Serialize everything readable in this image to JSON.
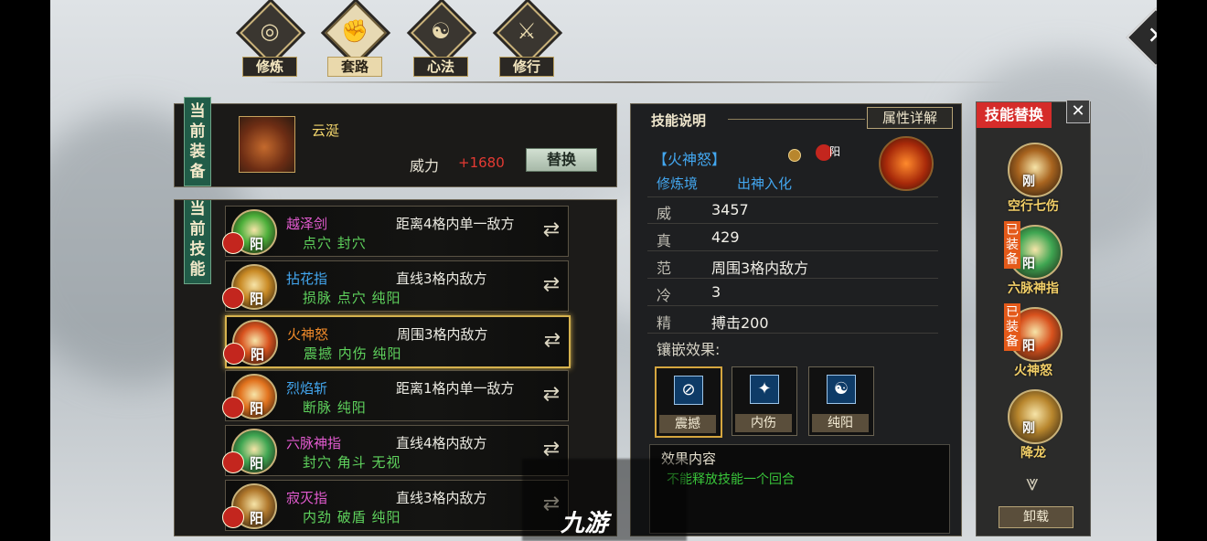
{
  "tabs": [
    {
      "label": "修炼",
      "glyph": "◎",
      "icon": "cultivation-icon",
      "active": false
    },
    {
      "label": "套路",
      "glyph": "✊",
      "icon": "fist-icon",
      "active": true
    },
    {
      "label": "心法",
      "glyph": "☯",
      "icon": "mind-method-icon",
      "active": false
    },
    {
      "label": "修行",
      "glyph": "⚔",
      "icon": "practice-icon",
      "active": false
    }
  ],
  "close_glyph": "✕",
  "equipment": {
    "tag": "当\n前\n装\n备",
    "name": "云涎",
    "power_label": "威力",
    "power_value": "+1680",
    "replace_label": "替换"
  },
  "current_skills": {
    "tag": "当\n前\n技\n能",
    "items": [
      {
        "name": "越泽剑",
        "name_color": "#e35bd0",
        "tags": "点穴  封穴",
        "range": "距离4格内单一敌方",
        "element": "阳",
        "icon_color": "#4caf3a",
        "selected": false
      },
      {
        "name": "拈花指",
        "name_color": "#43a7f0",
        "tags": "损脉  点穴  纯阳",
        "range": "直线3格内敌方",
        "element": "阳",
        "icon_color": "#c98a25",
        "selected": false
      },
      {
        "name": "火神怒",
        "name_color": "#ef8a2a",
        "tags": "震撼  内伤  纯阳",
        "range": "周围3格内敌方",
        "element": "阳",
        "icon_color": "#d8521e",
        "selected": true
      },
      {
        "name": "烈焰斩",
        "name_color": "#43a7f0",
        "tags": "断脉  纯阳",
        "range": "距离1格内单一敌方",
        "element": "阳",
        "icon_color": "#e2731e",
        "selected": false
      },
      {
        "name": "六脉神指",
        "name_color": "#e35bd0",
        "tags": "封穴  角斗  无视",
        "range": "直线4格内敌方",
        "element": "阳",
        "icon_color": "#3fa652",
        "selected": false
      },
      {
        "name": "寂灭指",
        "name_color": "#e35bd0",
        "tags": "内劲  破盾  纯阳",
        "range": "直线3格内敌方",
        "element": "阳",
        "icon_color": "#b0782c",
        "selected": false
      }
    ]
  },
  "skill_desc": {
    "title": "技能说明",
    "attr_button": "属性详解",
    "skill_name": "【火神怒】",
    "element": "阳",
    "realm_label": "修炼境",
    "realm_value": "出神入化",
    "stats": [
      {
        "key": "威",
        "value": "3457"
      },
      {
        "key": "真",
        "value": "429"
      },
      {
        "key": "范",
        "value": "周围3格内敌方"
      },
      {
        "key": "冷",
        "value": "3"
      },
      {
        "key": "精",
        "value": "搏击200"
      }
    ],
    "inlay_title": "镶嵌效果:",
    "inlays": [
      {
        "label": "震撼",
        "glyph": "⊘",
        "icon": "stun-icon",
        "selected": true
      },
      {
        "label": "内伤",
        "glyph": "✦",
        "icon": "internal-injury-icon",
        "selected": false
      },
      {
        "label": "纯阳",
        "glyph": "☯",
        "icon": "pure-yang-icon",
        "selected": false
      }
    ],
    "effect_title": "效果内容",
    "effect_text": "不能释放技能一个回合"
  },
  "skill_swap": {
    "title": "技能替换",
    "close_glyph": "✕",
    "items": [
      {
        "name": "空行七伤",
        "mark": "刚",
        "equipped": false,
        "icon_color": "#a8641f"
      },
      {
        "name": "六脉神指",
        "mark": "阳",
        "equipped": true,
        "tag": "已装备",
        "icon_color": "#3fa652"
      },
      {
        "name": "火神怒",
        "mark": "阳",
        "equipped": true,
        "tag": "已装备",
        "icon_color": "#d8521e"
      },
      {
        "name": "降龙",
        "mark": "刚",
        "equipped": false,
        "icon_color": "#b8862d"
      }
    ],
    "down_glyph": "⩔",
    "unload_label": "卸载"
  },
  "watermark": "九游"
}
